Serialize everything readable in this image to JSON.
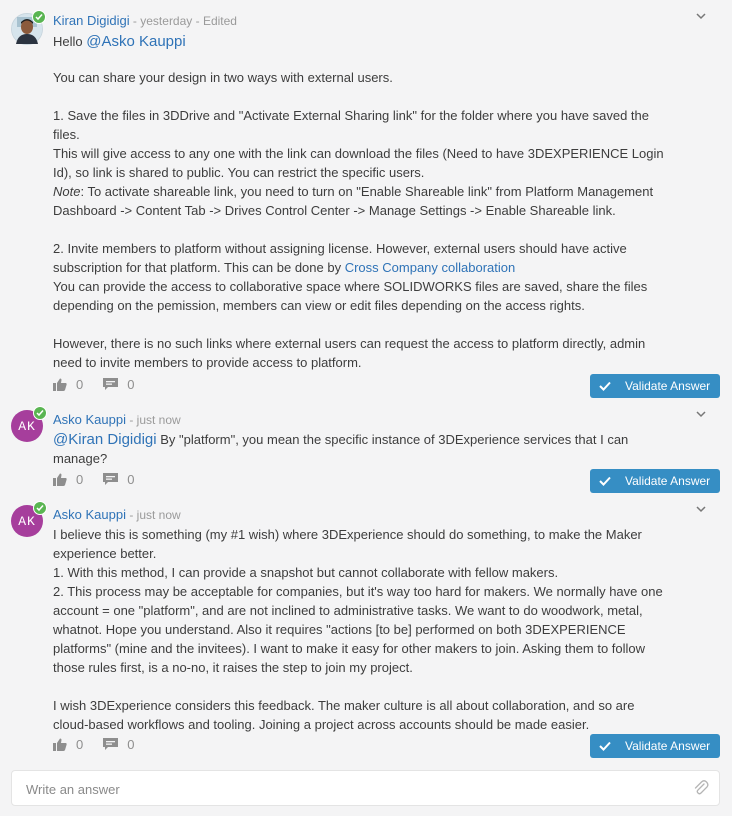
{
  "comments": [
    {
      "author": "Kiran Digidigi",
      "meta": " - yesterday - Edited",
      "greeting": "Hello ",
      "mention": "@Asko Kauppi",
      "p1": "You can share your design in two ways with external users.",
      "p2": "1. Save the files in 3DDrive and \"Activate External Sharing link\" for the folder where you have saved the files.",
      "p3": "This will give access to any one with the link can download the files (Need to have 3DEXPERIENCE Login Id), so link is shared to public. You can restrict the specific users.",
      "note_label": "Note",
      "note_text": ": To activate shareable link, you need to turn on \"Enable Shareable link\" from Platform Management Dashboard -> Content Tab -> Drives Control Center -> Manage Settings -> Enable Shareable link.",
      "p5": "2. Invite members to platform without assigning license. However, external users should have active subscription for that platform. This can be done by ",
      "p5_link": "Cross Company collaboration",
      "p6": "You can provide the access to collaborative space where SOLIDWORKS files are saved, share the files depending on the pemission, members can view or edit files depending on the access rights.",
      "p7": "However, there is no such links where external users can request the access to platform directly, admin need to invite members to provide access to platform.",
      "likes": "0",
      "replies": "0",
      "validate_label": "Validate Answer"
    },
    {
      "author": "Asko Kauppi",
      "initials": "AK",
      "meta": " - just now",
      "mention": "@Kiran Digidigi",
      "text": " By \"platform\", you mean the specific instance of 3DExperience services that I can manage?",
      "likes": "0",
      "replies": "0",
      "validate_label": "Validate Answer"
    },
    {
      "author": "Asko Kauppi",
      "initials": "AK",
      "meta": " - just now",
      "p1": "I believe this is something (my #1 wish) where 3DExperience should do something, to make the Maker experience better.",
      "p2": "1. With this method, I can provide a snapshot but cannot collaborate with fellow makers.",
      "p3": "2. This process may be acceptable for companies, but it's way too hard for makers. We normally have one account = one \"platform\", and are not inclined to administrative tasks. We want to do woodwork, metal, whatnot. Hope you understand. Also it requires \"actions [to be] performed on both 3DEXPERIENCE platforms\" (mine and the invitees). I want to make it easy for other makers to join. Asking them to follow those rules first, is a no-no, it raises the step to join my project.",
      "p4": "I wish 3DExperience considers this feedback. The maker culture is all about collaboration, and so are cloud-based workflows and tooling. Joining a project across accounts should be made easier.",
      "likes": "0",
      "replies": "0",
      "validate_label": "Validate Answer"
    }
  ],
  "answer_placeholder": "Write an answer",
  "icons": {
    "like": "thumbs-up-icon",
    "reply": "speech-bubble-icon",
    "validate": "checkmark-icon",
    "online": "checkmark-icon",
    "menu": "chevron-down-icon",
    "attach": "paperclip-icon"
  },
  "colors": {
    "link": "#2f73b7",
    "button": "#368ec4",
    "online": "#5ab552",
    "avatar_bg": "#a63e9c",
    "background": "#f4f4f5"
  }
}
